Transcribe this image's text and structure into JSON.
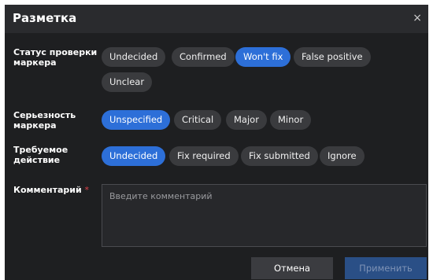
{
  "dialog": {
    "title": "Разметка",
    "close_icon": "×"
  },
  "fields": {
    "status": {
      "label": "Статус проверки маркера",
      "options": [
        "Undecided",
        "Confirmed",
        "Won't fix",
        "False positive",
        "Unclear"
      ],
      "selected": "Won't fix"
    },
    "severity": {
      "label": "Серьезность маркера",
      "options": [
        "Unspecified",
        "Critical",
        "Major",
        "Minor"
      ],
      "selected": "Unspecified"
    },
    "action": {
      "label": "Требуемое действие",
      "options": [
        "Undecided",
        "Fix required",
        "Fix submitted",
        "Ignore"
      ],
      "selected": "Undecided"
    },
    "comment": {
      "label": "Комментарий",
      "required_mark": "*",
      "placeholder": "Введите комментарий",
      "value": ""
    }
  },
  "footer": {
    "cancel_label": "Отмена",
    "apply_label": "Применить"
  },
  "colors": {
    "dialog_bg": "#1e1f21",
    "header_bg": "#2a2b2e",
    "chip_bg": "#3a3b3e",
    "chip_selected_bg": "#2d6fd8",
    "apply_disabled_bg": "#2a4f86",
    "required_star": "#e0434b"
  }
}
